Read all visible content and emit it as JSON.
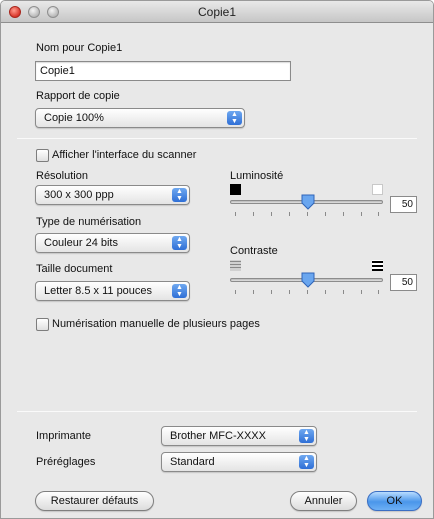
{
  "window": {
    "title": "Copie1"
  },
  "name_section": {
    "label": "Nom pour Copie1",
    "value": "Copie1"
  },
  "ratio_section": {
    "label": "Rapport de copie",
    "selected": "Copie 100%"
  },
  "scanner_interface": {
    "label": "Afficher l'interface du scanner",
    "checked": false
  },
  "resolution": {
    "label": "Résolution",
    "selected": "300 x 300 ppp"
  },
  "scan_type": {
    "label": "Type de numérisation",
    "selected": "Couleur 24 bits"
  },
  "doc_size": {
    "label": "Taille document",
    "selected": "Letter  8.5 x 11 pouces"
  },
  "brightness": {
    "label": "Luminosité",
    "value": "50",
    "level": 50
  },
  "contrast": {
    "label": "Contraste",
    "value": "50",
    "level": 50
  },
  "manual_multi": {
    "label": "Numérisation manuelle de plusieurs pages",
    "checked": false
  },
  "printer": {
    "label": "Imprimante",
    "selected": "Brother MFC-XXXX"
  },
  "presets": {
    "label": "Préréglages",
    "selected": "Standard"
  },
  "buttons": {
    "restore": "Restaurer défauts",
    "cancel": "Annuler",
    "ok": "OK"
  },
  "colors": {
    "accent": "#3a7fe0",
    "close": "#d8362a"
  }
}
